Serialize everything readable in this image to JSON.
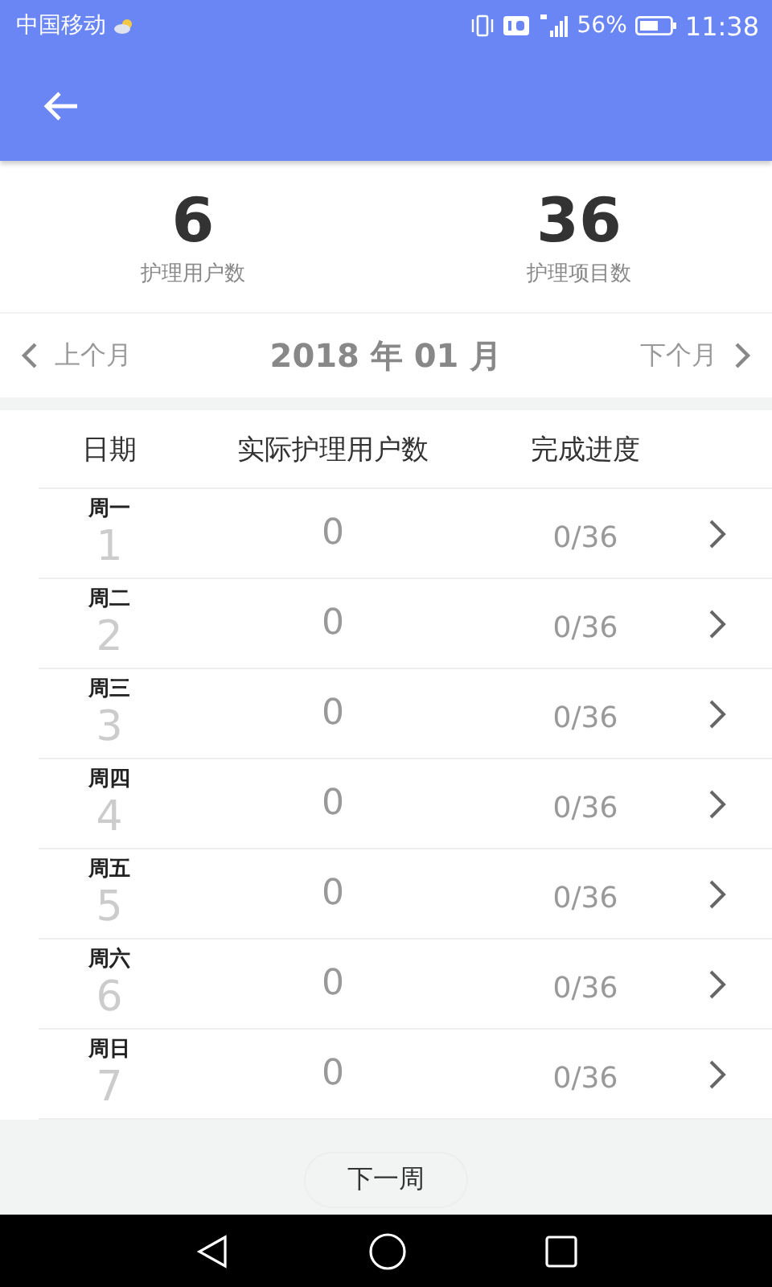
{
  "status_bar": {
    "carrier": "中国移动",
    "battery": "56%",
    "time": "11:38"
  },
  "stats": [
    {
      "value": "6",
      "label": "护理用户数"
    },
    {
      "value": "36",
      "label": "护理项目数"
    }
  ],
  "month_nav": {
    "prev": "上个月",
    "title": "2018 年 01 月",
    "next": "下个月"
  },
  "table": {
    "columns": [
      "日期",
      "实际护理用户数",
      "完成进度"
    ],
    "rows": [
      {
        "weekday": "周一",
        "day": "1",
        "users": "0",
        "progress": "0/36"
      },
      {
        "weekday": "周二",
        "day": "2",
        "users": "0",
        "progress": "0/36"
      },
      {
        "weekday": "周三",
        "day": "3",
        "users": "0",
        "progress": "0/36"
      },
      {
        "weekday": "周四",
        "day": "4",
        "users": "0",
        "progress": "0/36"
      },
      {
        "weekday": "周五",
        "day": "5",
        "users": "0",
        "progress": "0/36"
      },
      {
        "weekday": "周六",
        "day": "6",
        "users": "0",
        "progress": "0/36"
      },
      {
        "weekday": "周日",
        "day": "7",
        "users": "0",
        "progress": "0/36"
      }
    ]
  },
  "next_week_button": "下一周"
}
